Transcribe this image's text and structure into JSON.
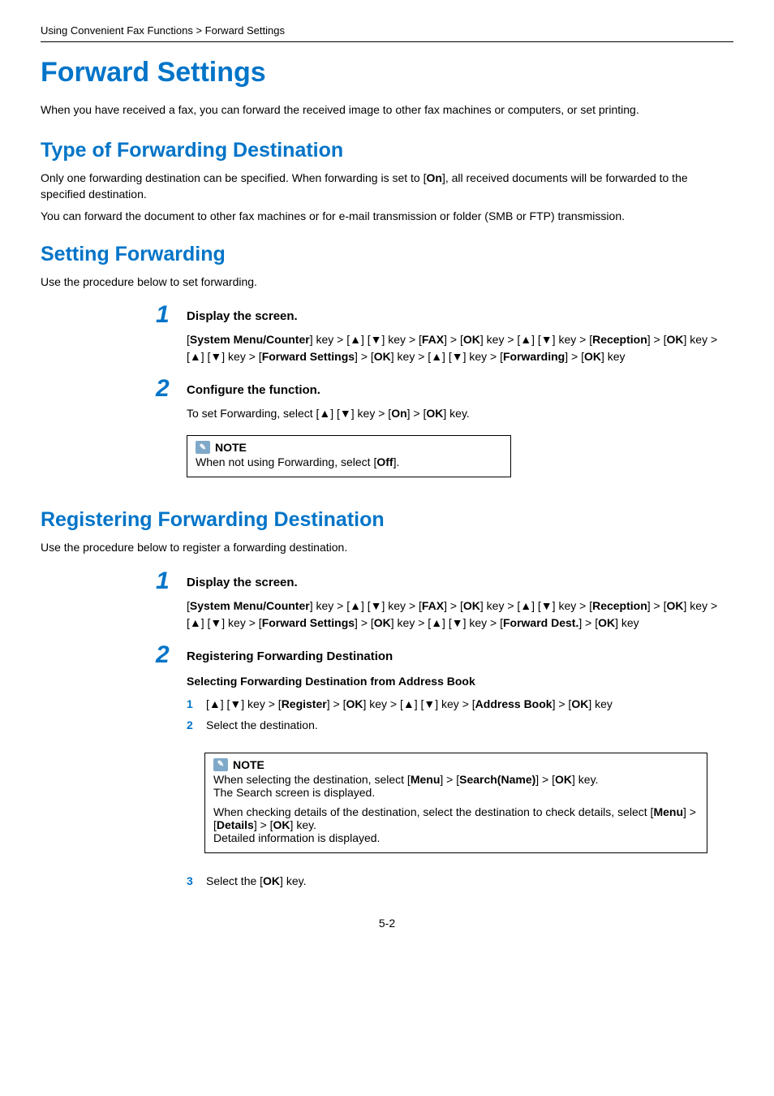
{
  "breadcrumb": "Using Convenient Fax Functions > Forward Settings",
  "h1": "Forward Settings",
  "intro": "When you have received a fax, you can forward the received image to other fax machines or computers, or set printing.",
  "sec1": {
    "title": "Type of Forwarding Destination",
    "p1_a": "Only one forwarding destination can be specified. When forwarding is set to [",
    "p1_bold": "On",
    "p1_b": "], all received documents will be forwarded to the specified destination.",
    "p2": "You can forward the document to other fax machines or for e-mail transmission or folder (SMB or FTP) transmission."
  },
  "sec2": {
    "title": "Setting Forwarding",
    "lead": "Use the procedure below to set forwarding.",
    "step1": {
      "title": "Display the screen.",
      "t1": "[",
      "b1": "System Menu/Counter",
      "t2": "] key > [▲] [▼] key > [",
      "b2": "FAX",
      "t3": "] > [",
      "b3": "OK",
      "t4": "] key > [▲] [▼] key > [",
      "b4": "Reception",
      "t5": "] > [",
      "b5": "OK",
      "t6": "] key > [▲] [▼] key > [",
      "b6": "Forward Settings",
      "t7": "] > [",
      "b7": "OK",
      "t8": "] key > [▲] [▼] key > [",
      "b8": "Forwarding",
      "t9": "] > [",
      "b9": "OK",
      "t10": "] key"
    },
    "step2": {
      "title": "Configure the function.",
      "t1": "To set Forwarding, select [▲] [▼] key > [",
      "b1": "On",
      "t2": "] > [",
      "b2": "OK",
      "t3": "] key."
    },
    "note": {
      "label": "NOTE",
      "t1": "When not using Forwarding, select [",
      "b1": "Off",
      "t2": "]."
    }
  },
  "sec3": {
    "title": "Registering Forwarding Destination",
    "lead": "Use the procedure below to register a forwarding destination.",
    "step1": {
      "title": "Display the screen.",
      "t1": "[",
      "b1": "System Menu/Counter",
      "t2": "] key > [▲] [▼] key > [",
      "b2": "FAX",
      "t3": "] > [",
      "b3": "OK",
      "t4": "] key > [▲] [▼] key > [",
      "b4": "Reception",
      "t5": "] > [",
      "b5": "OK",
      "t6": "] key > [▲] [▼] key > [",
      "b6": "Forward Settings",
      "t7": "] > [",
      "b7": "OK",
      "t8": "] key > [▲] [▼] key > [",
      "b8": "Forward Dest.",
      "t9": "] > [",
      "b9": "OK",
      "t10": "] key"
    },
    "step2": {
      "title": "Registering Forwarding Destination",
      "sub": "Selecting Forwarding Destination from Address Book",
      "li1": {
        "t1": "[▲] [▼] key > [",
        "b1": "Register",
        "t2": "] > [",
        "b2": "OK",
        "t3": "] key > [▲] [▼] key > [",
        "b3": "Address Book",
        "t4": "] > [",
        "b4": "OK",
        "t5": "] key"
      },
      "li2": "Select the destination.",
      "note": {
        "label": "NOTE",
        "l1a": "When selecting the destination, select [",
        "l1b1": "Menu",
        "l1b": "] > [",
        "l1b2": "Search(Name)",
        "l1c": "] > [",
        "l1b3": "OK",
        "l1d": "] key.",
        "l2": "The Search screen is displayed.",
        "l3a": "When checking details of the destination, select the destination to check details, select [",
        "l3b1": "Menu",
        "l3b": "] > [",
        "l3b2": "Details",
        "l3c": "] > [",
        "l3b3": "OK",
        "l3d": "] key.",
        "l4": "Detailed information is displayed."
      },
      "li3": {
        "t1": "Select the [",
        "b1": "OK",
        "t2": "] key."
      }
    }
  },
  "pagenum": "5-2"
}
